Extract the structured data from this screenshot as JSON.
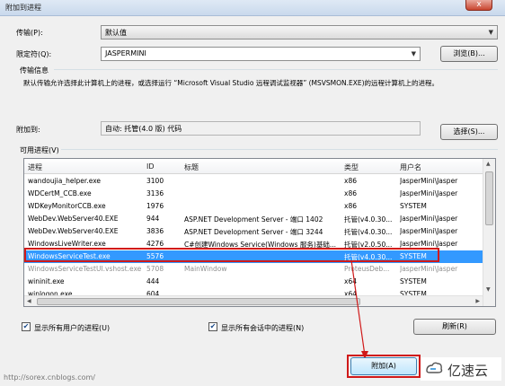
{
  "window": {
    "title": "附加到进程",
    "close_label": "x"
  },
  "transport": {
    "label": "传输(P):",
    "value": "默认值"
  },
  "qualifier": {
    "label": "限定符(Q):",
    "value": "JASPERMINI",
    "browse_label": "浏览(B)..."
  },
  "transport_info": {
    "heading": "传输信息",
    "text": "默认传输允许选择此计算机上的进程，或选择运行 “Microsoft Visual Studio 远程调试监视器” (MSVSMON.EXE)的远程计算机上的进程。"
  },
  "attach_to": {
    "label": "附加到:",
    "value": "自动: 托管(4.0 版) 代码",
    "select_label": "选择(S)..."
  },
  "processes": {
    "label": "可用进程(V)",
    "columns": [
      "进程",
      "ID",
      "标题",
      "类型",
      "用户名"
    ],
    "rows": [
      {
        "name": "wandoujia_helper.exe",
        "id": "3100",
        "title": "",
        "type": "x86",
        "user": "JasperMini\\Jasper"
      },
      {
        "name": "WDCertM_CCB.exe",
        "id": "3136",
        "title": "",
        "type": "x86",
        "user": "JasperMini\\Jasper"
      },
      {
        "name": "WDKeyMonitorCCB.exe",
        "id": "1976",
        "title": "",
        "type": "x86",
        "user": "SYSTEM"
      },
      {
        "name": "WebDev.WebServer40.EXE",
        "id": "944",
        "title": "ASP.NET Development Server - 端口 1402",
        "type": "托管(v4.0.30...",
        "user": "JasperMini\\Jasper"
      },
      {
        "name": "WebDev.WebServer40.EXE",
        "id": "3836",
        "title": "ASP.NET Development Server - 端口 3244",
        "type": "托管(v4.0.30...",
        "user": "JasperMini\\Jasper"
      },
      {
        "name": "WindowsLiveWriter.exe",
        "id": "4276",
        "title": "C#创建Windows Service(Windows 服务)基础...",
        "type": "托管(v2.0.50...",
        "user": "JasperMini\\Jasper"
      },
      {
        "name": "WindowsServiceTest.exe",
        "id": "5576",
        "title": "",
        "type": "托管(v4.0.30...",
        "user": "SYSTEM",
        "selected": true
      },
      {
        "name": "WindowsServiceTestUI.vshost.exe",
        "id": "5708",
        "title": "MainWindow",
        "type": "ProteusDeb...",
        "user": "JasperMini\\Jasper",
        "dim": true
      },
      {
        "name": "wininit.exe",
        "id": "444",
        "title": "",
        "type": "x64",
        "user": "SYSTEM"
      },
      {
        "name": "winlogon.exe",
        "id": "604",
        "title": "",
        "type": "x64",
        "user": "SYSTEM"
      }
    ]
  },
  "options": {
    "show_all_users": {
      "label": "显示所有用户的进程(U)",
      "checked": true
    },
    "show_all_sessions": {
      "label": "显示所有会话中的进程(N)",
      "checked": true
    },
    "refresh_label": "刷新(R)"
  },
  "footer": {
    "attach_label": "附加(A)",
    "watermark": "http://sorex.cnblogs.com/",
    "logo_text": "亿速云"
  },
  "colors": {
    "selection": "#3399ff",
    "highlight_box": "#d01919"
  }
}
